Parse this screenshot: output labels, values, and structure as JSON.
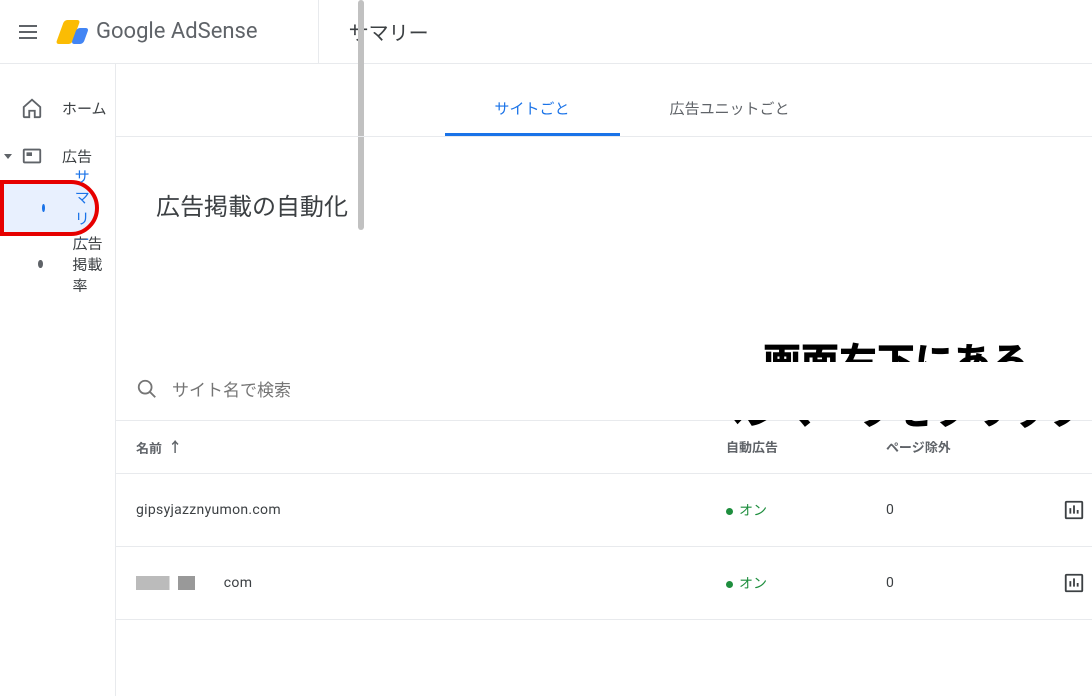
{
  "header": {
    "logo_text_google": "Google",
    "logo_text_product": " AdSense",
    "page_title": "サマリー"
  },
  "sidebar": {
    "home": "ホーム",
    "ads": "広告",
    "summary": "サマリー",
    "ad_rate": "広告掲載率"
  },
  "tabs": {
    "by_site": "サイトごと",
    "by_unit": "広告ユニットごと"
  },
  "section_title": "広告掲載の自動化",
  "annotation": {
    "line1": "画面右下にある",
    "line2": "ペンマークをクリック"
  },
  "search": {
    "placeholder": "サイト名で検索"
  },
  "table": {
    "headers": {
      "name": "名前",
      "auto_ads": "自動広告",
      "page_exclude": "ページ除外"
    },
    "rows": [
      {
        "name": "gipsyjazznyumon.com",
        "auto": "オン",
        "exclude": "0",
        "highlight_pen": true
      },
      {
        "name_redacted": true,
        "name_suffix": "com",
        "auto": "オン",
        "exclude": "0",
        "highlight_pen": false
      }
    ]
  }
}
